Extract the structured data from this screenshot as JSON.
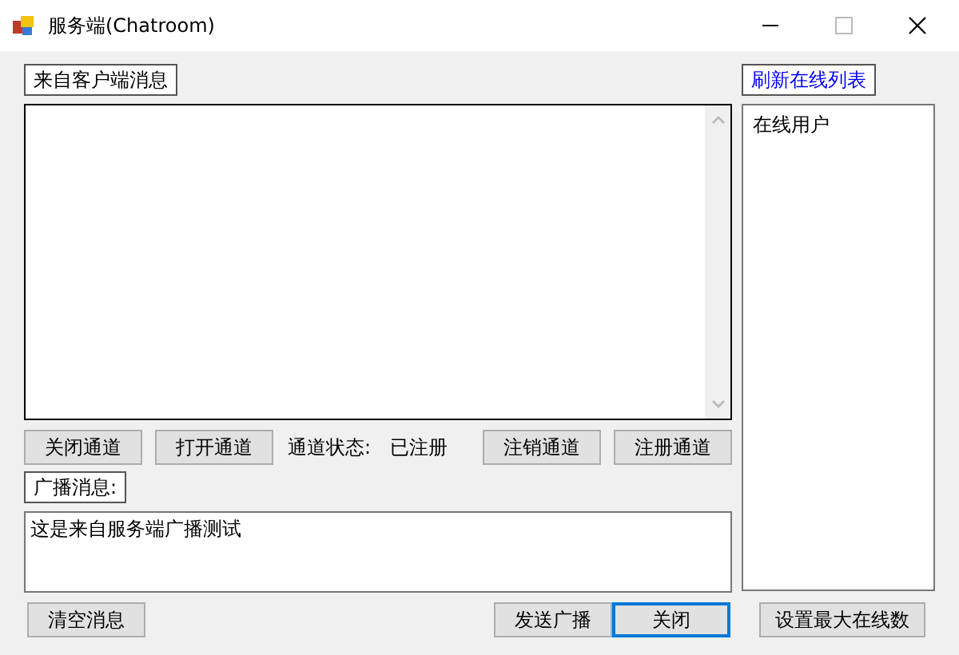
{
  "window": {
    "title": "服务端(Chatroom)"
  },
  "client_messages": {
    "label": "来自客户端消息"
  },
  "channel_buttons_left": [
    {
      "label": "关闭通道"
    },
    {
      "label": "打开通道"
    }
  ],
  "channel_status": {
    "label": "通道状态:",
    "value": "已注册"
  },
  "channel_buttons_right": [
    {
      "label": "注销通道"
    },
    {
      "label": "注册通道"
    }
  ],
  "broadcast": {
    "label": "广播消息:",
    "value": "这是来自服务端广播测试"
  },
  "online": {
    "refresh_label": "刷新在线列表",
    "items": [
      "在线用户"
    ]
  },
  "bottom_buttons": [
    {
      "label": "清空消息",
      "focused": false
    },
    {
      "label": "发送广播",
      "focused": false
    },
    {
      "label": "关闭",
      "focused": true
    }
  ],
  "max_online_button": {
    "label": "设置最大在线数"
  }
}
